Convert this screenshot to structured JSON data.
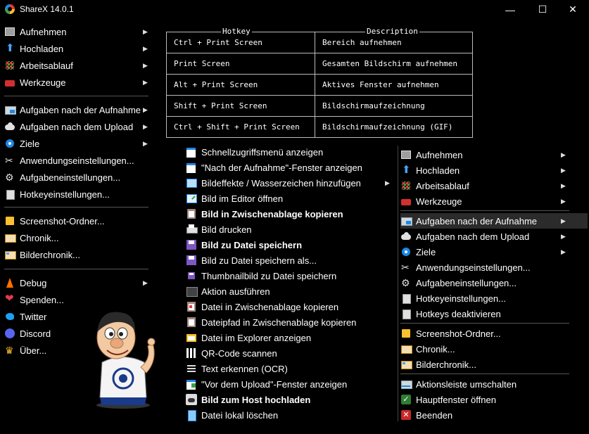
{
  "window": {
    "title": "ShareX 14.0.1",
    "minimize_glyph": "—",
    "maximize_glyph": "☐",
    "close_glyph": "✕"
  },
  "left_menu": {
    "group1": [
      {
        "label": "Aufnehmen",
        "icon": "screen-capture-icon",
        "arrow": "▶"
      },
      {
        "label": "Hochladen",
        "icon": "upload-arrow-icon",
        "arrow": "▶"
      },
      {
        "label": "Arbeitsablauf",
        "icon": "workflow-grid-icon",
        "arrow": "▶"
      },
      {
        "label": "Werkzeuge",
        "icon": "toolbox-icon",
        "arrow": "▶"
      }
    ],
    "group2": [
      {
        "label": "Aufgaben nach der Aufnahme",
        "icon": "after-capture-icon",
        "arrow": "▶"
      },
      {
        "label": "Aufgaben nach dem Upload",
        "icon": "cloud-upload-icon",
        "arrow": "▶"
      },
      {
        "label": "Ziele",
        "icon": "destinations-icon",
        "arrow": "▶"
      },
      {
        "label": "Anwendungseinstellungen...",
        "icon": "tools-icon",
        "arrow": ""
      },
      {
        "label": "Aufgabeneinstellungen...",
        "icon": "gear-icon",
        "arrow": ""
      },
      {
        "label": "Hotkeyeinstellungen...",
        "icon": "hotkey-icon",
        "arrow": ""
      }
    ],
    "group3": [
      {
        "label": "Screenshot-Ordner...",
        "icon": "folder-icon"
      },
      {
        "label": "Chronik...",
        "icon": "history-icon"
      },
      {
        "label": "Bilderchronik...",
        "icon": "image-history-icon"
      }
    ],
    "group4": [
      {
        "label": "Debug",
        "icon": "traffic-cone-icon",
        "arrow": "▶"
      },
      {
        "label": "Spenden...",
        "icon": "heart-icon",
        "arrow": ""
      },
      {
        "label": "Twitter",
        "icon": "twitter-bird-icon",
        "arrow": ""
      },
      {
        "label": "Discord",
        "icon": "discord-icon",
        "arrow": ""
      },
      {
        "label": "Über...",
        "icon": "crown-icon",
        "arrow": ""
      }
    ]
  },
  "hotkey_table": {
    "headers": {
      "hotkey": "Hotkey",
      "description": "Description"
    },
    "rows": [
      {
        "hotkey": "Ctrl + Print Screen",
        "description": "Bereich aufnehmen"
      },
      {
        "hotkey": "Print Screen",
        "description": "Gesamten Bildschirm aufnehmen"
      },
      {
        "hotkey": "Alt + Print Screen",
        "description": "Aktives Fenster aufnehmen"
      },
      {
        "hotkey": "Shift + Print Screen",
        "description": "Bildschirmaufzeichnung"
      },
      {
        "hotkey": "Ctrl + Shift + Print Screen",
        "description": "Bildschirmaufzeichnung (GIF)"
      }
    ]
  },
  "after_capture_menu": [
    {
      "label": "Schnellzugriffsmenü anzeigen",
      "icon": "quick-menu-icon",
      "bold": false,
      "arrow": ""
    },
    {
      "label": "\"Nach der Aufnahme\"-Fenster anzeigen",
      "icon": "window-icon",
      "bold": false,
      "arrow": ""
    },
    {
      "label": "Bildeffekte / Wasserzeichen hinzufügen",
      "icon": "image-effects-icon",
      "bold": false,
      "arrow": "▶"
    },
    {
      "label": "Bild im Editor öffnen",
      "icon": "editor-icon",
      "bold": false,
      "arrow": ""
    },
    {
      "label": "Bild in Zwischenablage kopieren",
      "icon": "clipboard-image-icon",
      "bold": true,
      "arrow": ""
    },
    {
      "label": "Bild drucken",
      "icon": "printer-icon",
      "bold": false,
      "arrow": ""
    },
    {
      "label": "Bild zu Datei speichern",
      "icon": "save-disk-icon",
      "bold": true,
      "arrow": ""
    },
    {
      "label": "Bild zu Datei speichern als...",
      "icon": "save-as-icon",
      "bold": false,
      "arrow": ""
    },
    {
      "label": "Thumbnailbild zu Datei speichern",
      "icon": "thumbnail-save-icon",
      "bold": false,
      "arrow": ""
    },
    {
      "label": "Aktion ausführen",
      "icon": "terminal-icon",
      "bold": false,
      "arrow": ""
    },
    {
      "label": "Datei in Zwischenablage kopieren",
      "icon": "clipboard-file-icon",
      "bold": false,
      "arrow": ""
    },
    {
      "label": "Dateipfad in Zwischenablage kopieren",
      "icon": "clipboard-path-icon",
      "bold": false,
      "arrow": ""
    },
    {
      "label": "Datei im Explorer anzeigen",
      "icon": "explorer-icon",
      "bold": false,
      "arrow": ""
    },
    {
      "label": "QR-Code scannen",
      "icon": "qr-code-icon",
      "bold": false,
      "arrow": ""
    },
    {
      "label": "Text erkennen (OCR)",
      "icon": "ocr-text-icon",
      "bold": false,
      "arrow": ""
    },
    {
      "label": "\"Vor dem Upload\"-Fenster anzeigen",
      "icon": "before-upload-window-icon",
      "bold": false,
      "arrow": ""
    },
    {
      "label": "Bild zum Host hochladen",
      "icon": "upload-cloud-icon",
      "bold": true,
      "arrow": ""
    },
    {
      "label": "Datei lokal löschen",
      "icon": "delete-file-icon",
      "bold": false,
      "arrow": ""
    }
  ],
  "tray_menu": {
    "group1": [
      {
        "label": "Aufnehmen",
        "icon": "screen-capture-icon",
        "arrow": "▶"
      },
      {
        "label": "Hochladen",
        "icon": "upload-arrow-icon",
        "arrow": "▶"
      },
      {
        "label": "Arbeitsablauf",
        "icon": "workflow-grid-icon",
        "arrow": "▶"
      },
      {
        "label": "Werkzeuge",
        "icon": "toolbox-icon",
        "arrow": "▶"
      }
    ],
    "group2": [
      {
        "label": "Aufgaben nach der Aufnahme",
        "icon": "after-capture-icon",
        "arrow": "▶"
      },
      {
        "label": "Aufgaben nach dem Upload",
        "icon": "cloud-upload-icon",
        "arrow": "▶"
      },
      {
        "label": "Ziele",
        "icon": "destinations-icon",
        "arrow": "▶"
      },
      {
        "label": "Anwendungseinstellungen...",
        "icon": "tools-icon",
        "arrow": ""
      },
      {
        "label": "Aufgabeneinstellungen...",
        "icon": "gear-icon",
        "arrow": ""
      },
      {
        "label": "Hotkeyeinstellungen...",
        "icon": "hotkey-icon",
        "arrow": ""
      },
      {
        "label": "Hotkeys deaktivieren",
        "icon": "hotkey-disable-icon",
        "arrow": ""
      }
    ],
    "group3": [
      {
        "label": "Screenshot-Ordner...",
        "icon": "folder-icon"
      },
      {
        "label": "Chronik...",
        "icon": "history-icon"
      },
      {
        "label": "Bilderchronik...",
        "icon": "image-history-icon"
      }
    ],
    "group4": [
      {
        "label": "Aktionsleiste umschalten",
        "icon": "action-bar-icon"
      },
      {
        "label": "Hauptfenster öffnen",
        "icon": "checkmark-icon"
      },
      {
        "label": "Beenden",
        "icon": "exit-x-icon"
      }
    ]
  }
}
